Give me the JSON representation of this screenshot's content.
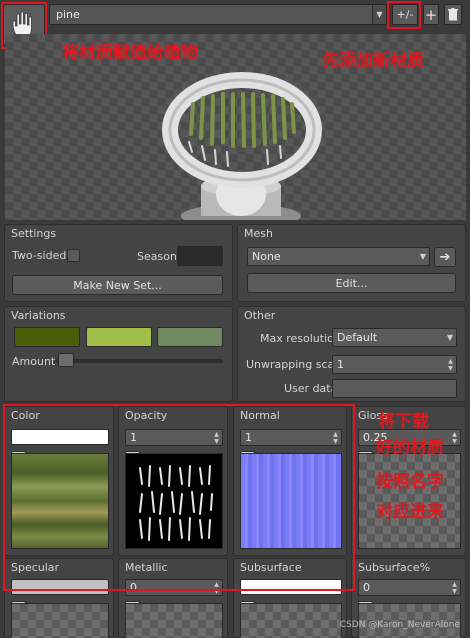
{
  "toolbar": {
    "material_name": "pine",
    "toggle_label": "+/-",
    "add_label": "+"
  },
  "annotations": {
    "assign": "将材质赋值给植物",
    "add_new": "先添加新材质",
    "download": [
      "将下载",
      "好的材质",
      "按照名字",
      "对应进来"
    ]
  },
  "settings": {
    "title": "Settings",
    "two_sided_label": "Two-sided",
    "season_label": "Season",
    "make_new_set_label": "Make New Set..."
  },
  "mesh": {
    "title": "Mesh",
    "value": "None",
    "edit_label": "Edit..."
  },
  "variations": {
    "title": "Variations",
    "amount_label": "Amount",
    "colors": [
      "#4a5e0c",
      "#9fbf48",
      "#6f8a63"
    ],
    "amount_value": 0.02
  },
  "other": {
    "title": "Other",
    "max_resolution_label": "Max resolution",
    "max_resolution_value": "Default",
    "unwrapping_scale_label": "Unwrapping scale",
    "unwrapping_scale_value": "1",
    "user_data_label": "User data",
    "user_data_value": ""
  },
  "textures": [
    {
      "label": "Color",
      "kind": "color"
    },
    {
      "label": "Opacity",
      "value": "1"
    },
    {
      "label": "Normal",
      "value": "1"
    },
    {
      "label": "Gloss",
      "value": "0.25"
    }
  ],
  "textures_row2": [
    {
      "label": "Specular",
      "kind": "color"
    },
    {
      "label": "Metallic",
      "value": "0"
    },
    {
      "label": "Subsurface",
      "kind": "color"
    },
    {
      "label": "Subsurface%",
      "value": "0"
    }
  ],
  "watermark": "CSDN @Karon_NeverAlone"
}
